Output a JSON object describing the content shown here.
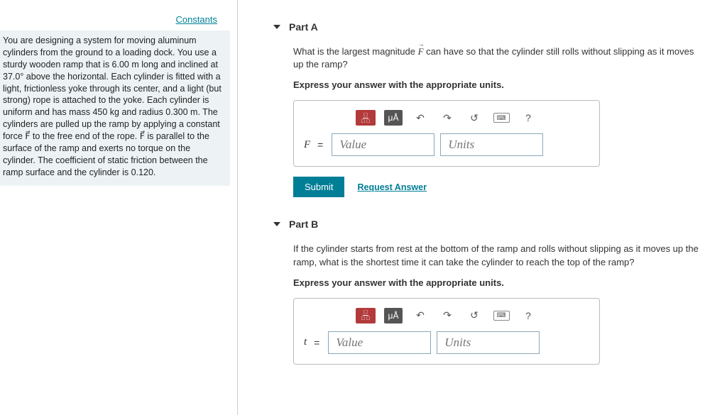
{
  "sidebar": {
    "constants_link": "Constants",
    "problem_text": "You are designing a system for moving aluminum cylinders from the ground to a loading dock. You use a sturdy wooden ramp that is 6.00  m long and inclined at 37.0° above the horizontal. Each cylinder is fitted with a light, frictionless yoke through its center, and a light (but strong) rope is attached to the yoke. Each cylinder is uniform and has mass 450  kg and radius 0.300 m. The cylinders are pulled up the ramp by applying a constant force F⃗ to the free end of the rope. F⃗ is parallel to the surface of the ramp and exerts no torque on the cylinder. The coefficient of static friction between the ramp surface and the cylinder is 0.120."
  },
  "partA": {
    "title": "Part A",
    "question_pre": "What is the largest magnitude ",
    "question_vec": "F",
    "question_post": " can have so that the cylinder still rolls without slipping as it moves up the ramp?",
    "instruction": "Express your answer with the appropriate units.",
    "var": "F",
    "value_placeholder": "Value",
    "units_placeholder": "Units",
    "submit": "Submit",
    "request": "Request Answer"
  },
  "partB": {
    "title": "Part B",
    "question": "If the cylinder starts from rest at the bottom of the ramp and rolls without slipping as it moves up the ramp, what is the shortest time it can take the cylinder to reach the top of the ramp?",
    "instruction": "Express your answer with the appropriate units.",
    "var": "t",
    "value_placeholder": "Value",
    "units_placeholder": "Units"
  },
  "toolbar": {
    "mu": "μÅ",
    "undo": "↶",
    "redo": "↷",
    "reset": "↺",
    "help": "?"
  }
}
